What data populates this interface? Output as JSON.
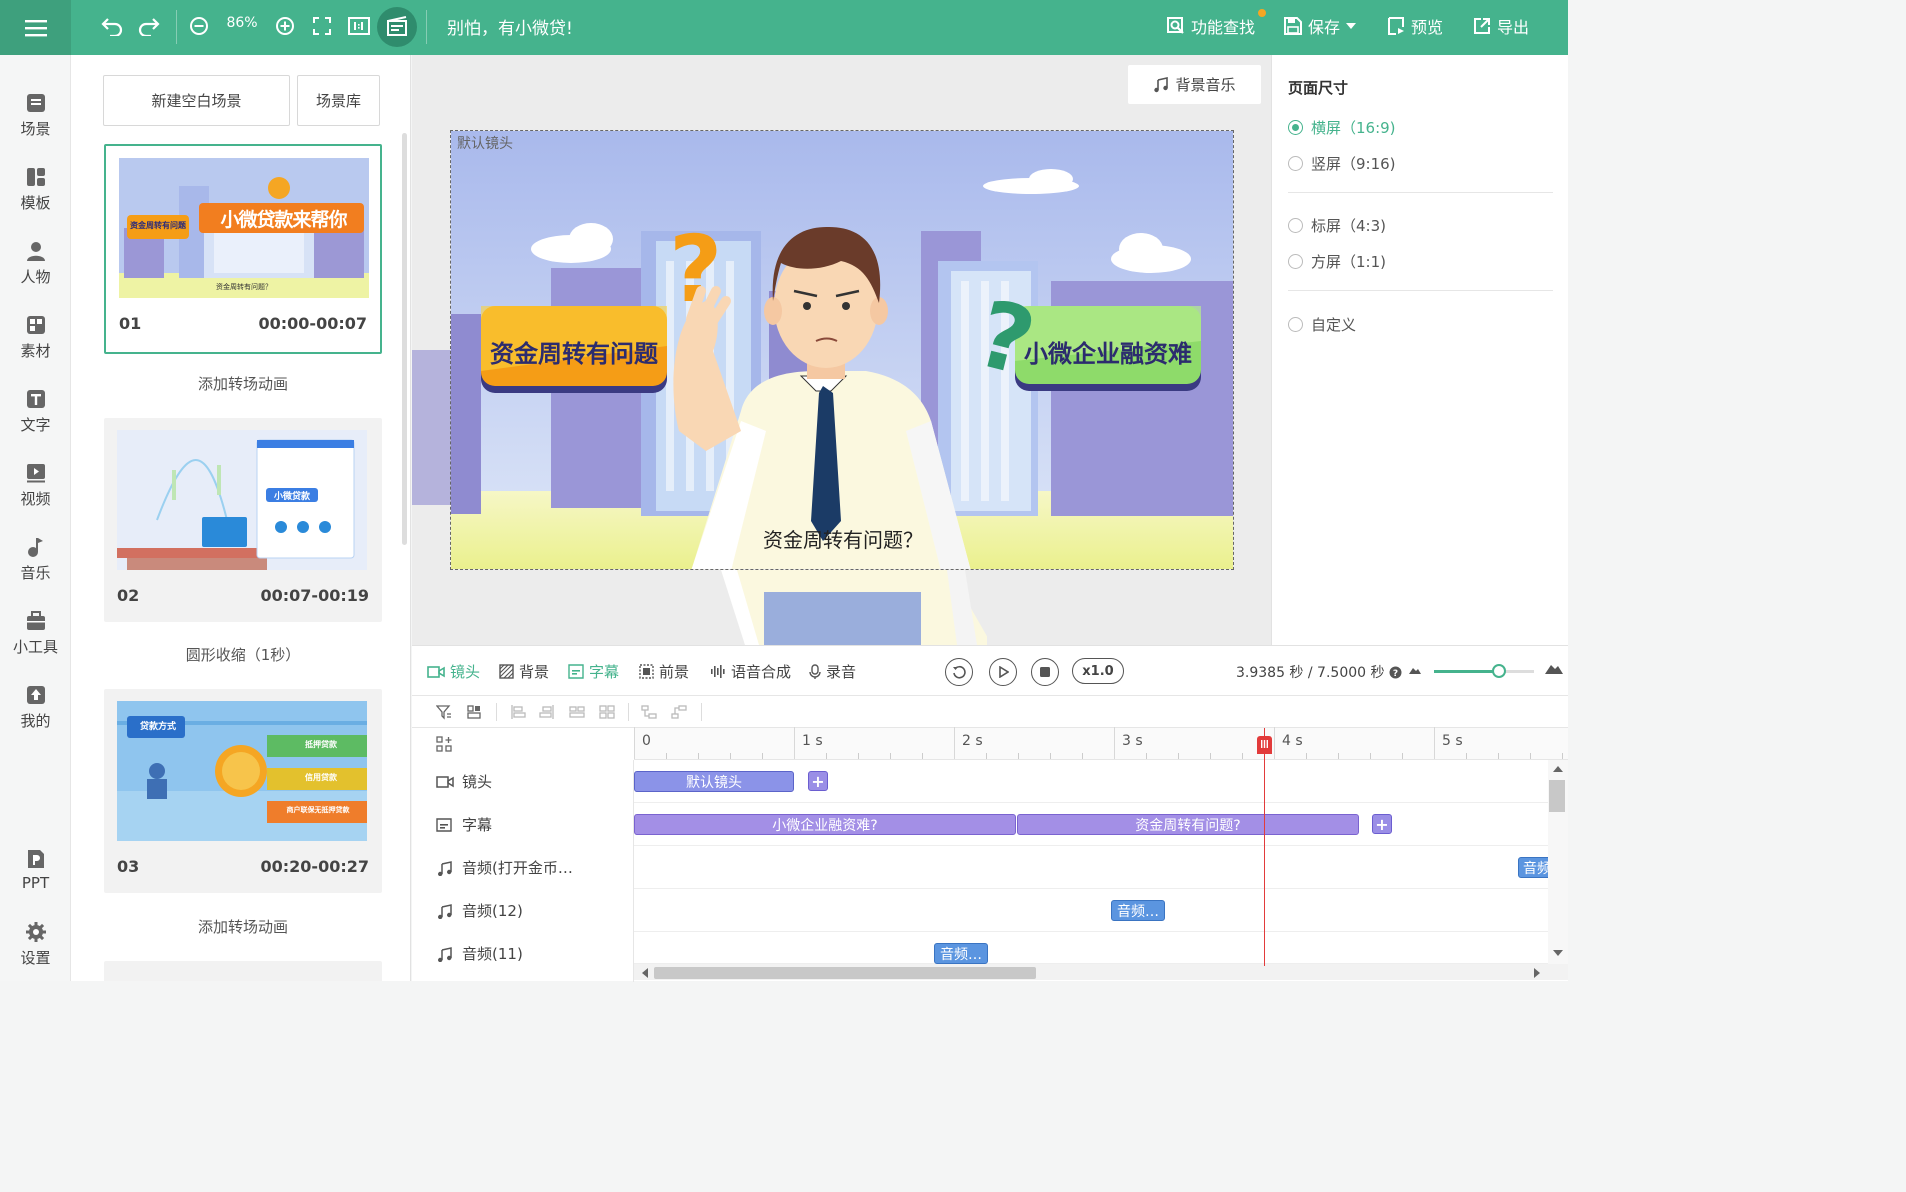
{
  "topbar": {
    "zoom_level": "86%",
    "app_title": "别怕，有小微贷!",
    "feature_search": "功能查找",
    "save": "保存",
    "preview": "预览",
    "export": "导出"
  },
  "nav": [
    {
      "label": "场景",
      "icon": "scene-icon"
    },
    {
      "label": "模板",
      "icon": "template-icon"
    },
    {
      "label": "人物",
      "icon": "person-icon"
    },
    {
      "label": "素材",
      "icon": "material-icon"
    },
    {
      "label": "文字",
      "icon": "text-icon"
    },
    {
      "label": "视频",
      "icon": "video-icon"
    },
    {
      "label": "音乐",
      "icon": "music-icon"
    },
    {
      "label": "小工具",
      "icon": "toolbox-icon"
    },
    {
      "label": "我的",
      "icon": "upload-icon"
    },
    {
      "label": "PPT",
      "icon": "ppt-icon"
    },
    {
      "label": "设置",
      "icon": "settings-icon"
    }
  ],
  "scene_panel": {
    "new_blank_scene": "新建空白场景",
    "scene_library": "场景库",
    "scenes": [
      {
        "num": "01",
        "time": "00:00-00:07",
        "thumb_title": "小微贷款来帮你",
        "thumb_tag": "资金周转有问题",
        "thumb_caption": "资金周转有问题？"
      },
      {
        "num": "02",
        "time": "00:07-00:19",
        "thumb_title": "小微贷款"
      },
      {
        "num": "03",
        "time": "00:20-00:27",
        "thumb_title": "贷款方式",
        "thumb_tags": [
          "抵押贷款",
          "信用贷款",
          "商户联保无抵押贷款"
        ]
      }
    ],
    "transitions": [
      "添加转场动画",
      "圆形收缩（1秒）",
      "添加转场动画"
    ]
  },
  "canvas": {
    "bgm_button": "背景音乐",
    "lens_label": "默认镜头",
    "left_banner": "资金周转有问题",
    "right_banner": "小微企业融资难",
    "subtitle": "资金周转有问题？"
  },
  "right_panel": {
    "title": "页面尺寸",
    "options": [
      {
        "label": "横屏（16:9)",
        "selected": true
      },
      {
        "label": "竖屏（9:16)",
        "selected": false
      },
      {
        "label": "标屏（4:3)",
        "selected": false
      },
      {
        "label": "方屏（1:1)",
        "selected": false
      },
      {
        "label": "自定义",
        "selected": false
      }
    ]
  },
  "timeline": {
    "tabs": [
      {
        "label": "镜头",
        "active": true
      },
      {
        "label": "背景",
        "active": false
      },
      {
        "label": "字幕",
        "active": true
      },
      {
        "label": "前景",
        "active": false
      },
      {
        "label": "语音合成",
        "active": false
      },
      {
        "label": "录音",
        "active": false
      }
    ],
    "speed": "x1.0",
    "time_readout": "3.9385 秒 / 7.5000 秒",
    "zoom_value": 0.65,
    "ruler_ticks": [
      "0",
      "1 s",
      "2 s",
      "3 s",
      "4 s",
      "5 s"
    ],
    "tracks": [
      {
        "label": "镜头",
        "icon": "camera-icon"
      },
      {
        "label": "字幕",
        "icon": "subtitle-icon"
      },
      {
        "label": "音频(打开金币…",
        "icon": "audio-icon"
      },
      {
        "label": "音频(12)",
        "icon": "audio-icon"
      },
      {
        "label": "音频(11)",
        "icon": "audio-icon"
      }
    ],
    "clips": {
      "lens": "默认镜头",
      "sub1": "小微企业融资难?",
      "sub2": "资金周转有问题?",
      "audio_a": "音频…",
      "audio_b": "音频…",
      "audio_c": "音频…"
    }
  },
  "colors": {
    "brand": "#45b38d",
    "playhead": "#e23b3b"
  }
}
